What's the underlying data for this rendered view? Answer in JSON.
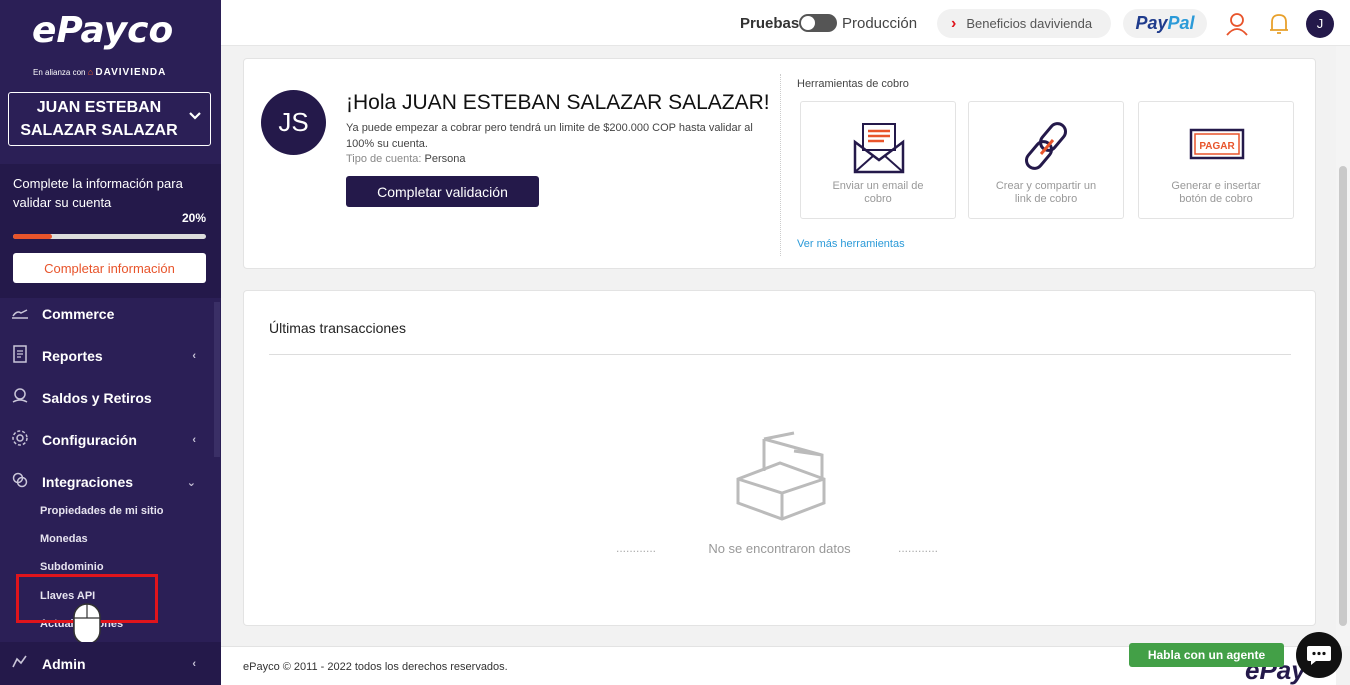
{
  "sidebar": {
    "logo": "ePayco",
    "alliance_prefix": "En alianza con",
    "alliance_brand": "DAVIVIENDA",
    "user_name_line1": "JUAN ESTEBAN",
    "user_name_line2": "SALAZAR SALAZAR",
    "complete_text": "Complete la información para validar su cuenta",
    "progress_label": "20%",
    "progress_value": 20,
    "complete_button": "Completar información",
    "menu": [
      {
        "label": "Commerce",
        "icon": "commerce-icon",
        "has_arrow": false
      },
      {
        "label": "Reportes",
        "icon": "report-icon",
        "has_arrow": true
      },
      {
        "label": "Saldos y Retiros",
        "icon": "money-icon",
        "has_arrow": false
      },
      {
        "label": "Configuración",
        "icon": "gear-icon",
        "has_arrow": true
      },
      {
        "label": "Integraciones",
        "icon": "integrations-icon",
        "has_arrow": true
      }
    ],
    "submenu": [
      "Propiedades de mi sitio",
      "Monedas",
      "Subdominio",
      "Llaves API",
      "Actualizaciones"
    ],
    "admin": "Admin"
  },
  "topbar": {
    "mode_test": "Pruebas",
    "mode_prod": "Producción",
    "benefits": "Beneficios davivienda",
    "paypal_a": "Pay",
    "paypal_b": "Pal",
    "avatar_initial": "J"
  },
  "welcome": {
    "initials": "JS",
    "greeting": "¡Hola JUAN ESTEBAN SALAZAR SALAZAR!",
    "subtitle": "Ya puede empezar a cobrar pero tendrá un limite de $200.000 COP hasta validar al 100% su cuenta.",
    "account_type_label": "Tipo de cuenta:",
    "account_type_value": "Persona",
    "validate_button": "Completar validación",
    "tools_title": "Herramientas de cobro",
    "tools": [
      {
        "label": "Enviar un email de cobro",
        "icon": "email-icon"
      },
      {
        "label": "Crear y compartir un link de cobro",
        "icon": "link-icon"
      },
      {
        "label": "Generar e insertar botón de cobro",
        "icon": "pay-button-icon",
        "badge": "PAGAR"
      }
    ],
    "more_tools": "Ver más herramientas"
  },
  "transactions": {
    "title": "Últimas transacciones",
    "empty": "No se encontraron datos",
    "dots": "............"
  },
  "footer": {
    "copyright": "ePayco © 2011 - 2022 todos los derechos reservados.",
    "agent_button": "Habla con un agente",
    "footer_logo": "ePay"
  },
  "colors": {
    "sidebar": "#2b1f56",
    "accent": "#e8542b",
    "primary": "#24194a",
    "link": "#2b9ad8",
    "agent": "#43a047"
  }
}
